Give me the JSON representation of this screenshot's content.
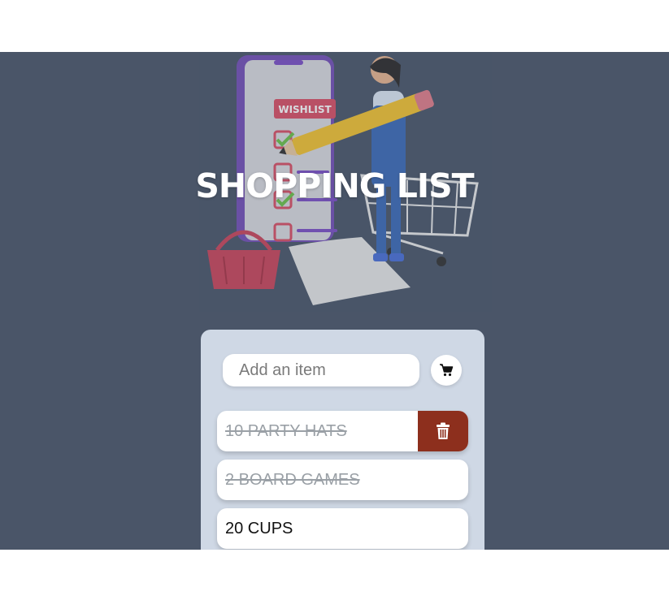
{
  "header": {
    "title": "SHOPPING LIST"
  },
  "hero": {
    "wishlist_label": "WISHLIST"
  },
  "form": {
    "placeholder": "Add an item",
    "submit_icon": "cart-icon"
  },
  "items": [
    {
      "label": "10 PARTY HATS",
      "done": true,
      "show_delete": true
    },
    {
      "label": "2 BOARD GAMES",
      "done": true,
      "show_delete": false
    },
    {
      "label": "20 CUPS",
      "done": false,
      "show_delete": false
    }
  ],
  "colors": {
    "background": "#4a5568",
    "card": "#cfd8e5",
    "delete": "#8d2f1d"
  }
}
